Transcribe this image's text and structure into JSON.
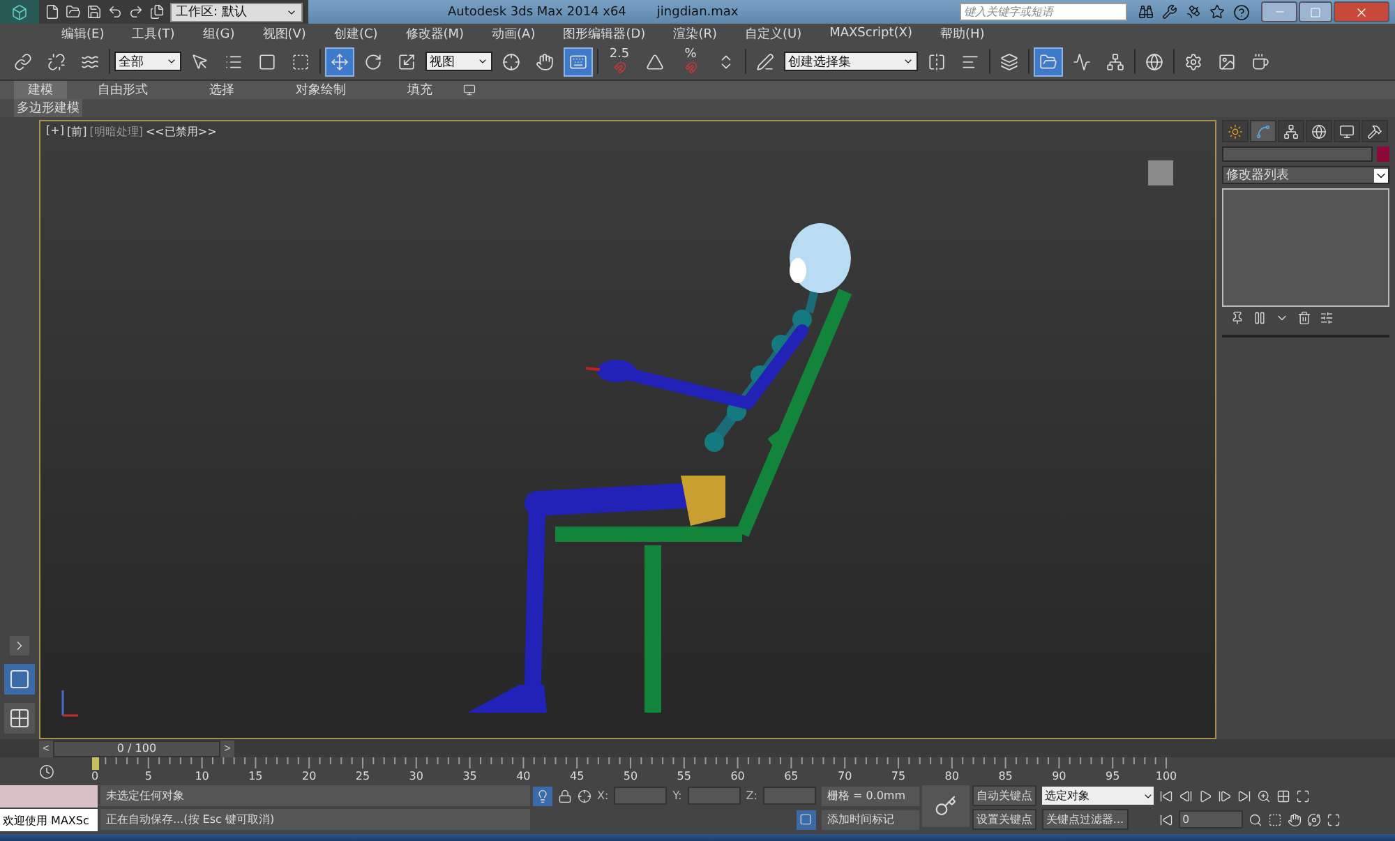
{
  "title_bar": {
    "workspace": "工作区: 默认",
    "app_title": "Autodesk 3ds Max  2014 x64",
    "file_name": "jingdian.max",
    "search": {
      "placeholder": "键入关键字或短语"
    }
  },
  "menu": [
    "编辑(E)",
    "工具(T)",
    "组(G)",
    "视图(V)",
    "创建(C)",
    "修改器(M)",
    "动画(A)",
    "图形编辑器(D)",
    "渲染(R)",
    "自定义(U)",
    "MAXScript(X)",
    "帮助(H)"
  ],
  "main_toolbar": {
    "selection_filter": "全部",
    "reference_coordinate": "视图",
    "named_selection": "创建选择集",
    "snap_labels": [
      "2.5",
      "%"
    ],
    "tools": [
      {
        "selected": false
      },
      {
        "selected": false
      },
      {
        "selected": false
      },
      {
        "selected": false
      },
      {
        "selected": false
      },
      {
        "selected": false
      },
      {
        "selected": false
      },
      {
        "selected": true
      },
      {
        "selected": false
      },
      {
        "selected": false
      },
      {
        "selected": false
      },
      {
        "selected": false
      },
      {
        "selected": true
      },
      {
        "selected": false
      },
      {
        "selected": false
      },
      {
        "selected": false
      },
      {
        "selected": false
      },
      {
        "selected": false
      },
      {
        "selected": false
      },
      {
        "selected": false
      },
      {
        "selected": false
      },
      {
        "selected": true
      },
      {
        "selected": false
      },
      {
        "selected": false
      },
      {
        "selected": false
      },
      {
        "selected": false
      },
      {
        "selected": false
      },
      {
        "selected": false
      }
    ]
  },
  "ribbon": {
    "tabs": [
      {
        "label": "建模",
        "selected": true
      },
      {
        "label": "自由形式",
        "selected": false
      },
      {
        "label": "选择",
        "selected": false
      },
      {
        "label": "对象绘制",
        "selected": false
      },
      {
        "label": "填充",
        "selected": false
      }
    ],
    "panel": "多边形建模"
  },
  "viewport": {
    "labels": [
      "[+]",
      "[前]",
      "[明暗处理]",
      "<<已禁用>>"
    ]
  },
  "command_panel": {
    "tabs": [
      {
        "selected": false
      },
      {
        "selected": true
      },
      {
        "selected": false
      },
      {
        "selected": false
      },
      {
        "selected": false
      },
      {
        "selected": false
      }
    ],
    "modifier_list": "修改器列表"
  },
  "time_slider": {
    "prev": "<",
    "position": "0 / 100",
    "next": ">"
  },
  "timeline": {
    "labels": [
      "0",
      "5",
      "10",
      "15",
      "20",
      "25",
      "30",
      "35",
      "40",
      "45",
      "50",
      "55",
      "60",
      "65",
      "70",
      "75",
      "80",
      "85",
      "90",
      "95",
      "100"
    ]
  },
  "status": {
    "maxscript": "欢迎使用 MAXSc",
    "prompt": "未选定任何对象",
    "message": "正在自动保存...(按 Esc 键可取消)",
    "axes": [
      "X:",
      "Y:",
      "Z:"
    ],
    "grid": "栅格 = 0.0mm",
    "add_time_tag": "添加时间标记",
    "auto_key": {
      "label": "自动关键点",
      "on": false
    },
    "set_key": "设置关键点",
    "key_mode": "选定对象",
    "key_filters": "关键点过滤器...",
    "frame": "0"
  }
}
